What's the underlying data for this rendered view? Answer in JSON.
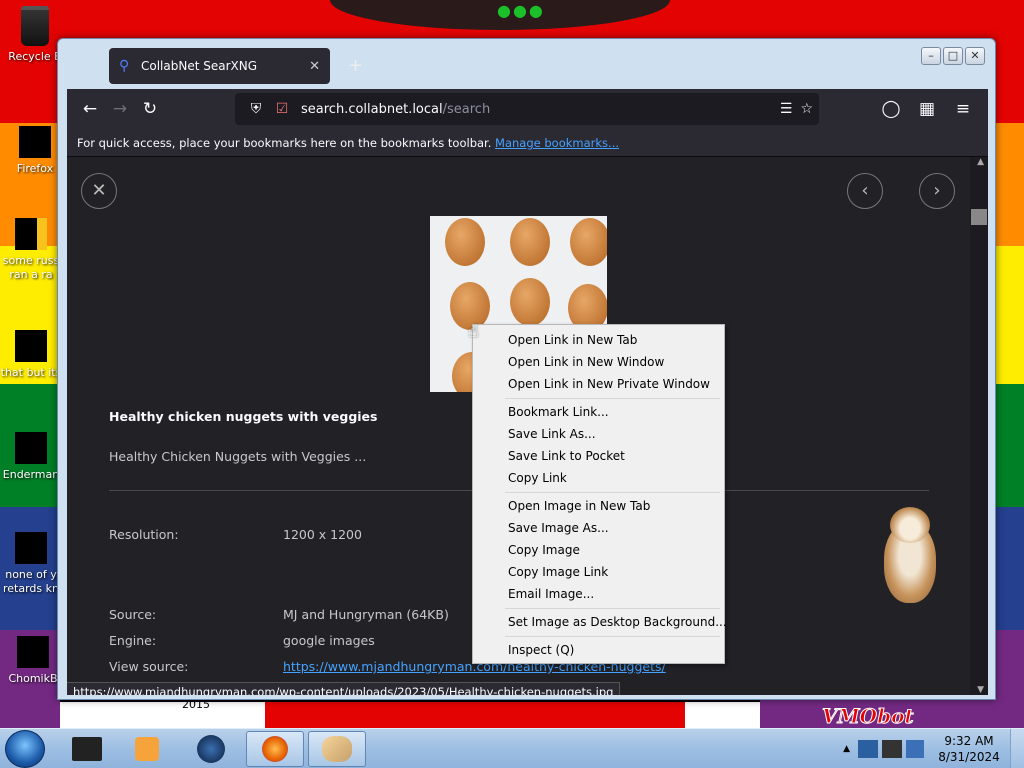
{
  "desktop": {
    "icons": [
      {
        "label": "Recycle B",
        "icon": "recycle-bin-icon"
      },
      {
        "label": "Firefox",
        "icon": "firefox-icon"
      },
      {
        "label": "some russ ran a ra",
        "icon": "file-icon"
      },
      {
        "label": "that but its",
        "icon": "file-icon"
      },
      {
        "label": "Enderman",
        "icon": "file-icon"
      },
      {
        "label": "none of y retards kn",
        "icon": "file-icon"
      },
      {
        "label": "ChomikB",
        "icon": "file-icon"
      }
    ],
    "wallpaper_text": "VMObot",
    "wallpaper_year": "2015"
  },
  "browser": {
    "tab_title": "CollabNet SearXNG",
    "url_host": "search.collabnet.local",
    "url_path": "/search",
    "bookmarks_hint": "For quick access, place your bookmarks here on the bookmarks toolbar.",
    "bookmarks_link": "Manage bookmarks...",
    "status_url": "https://www.mjandhungryman.com/wp-content/uploads/2023/05/Healthy-chicken-nuggets.jpg"
  },
  "result": {
    "title": "Healthy chicken nuggets with veggies",
    "description": "Healthy Chicken Nuggets with Veggies ...",
    "resolution_label": "Resolution:",
    "resolution": "1200 x 1200",
    "source_label": "Source:",
    "source": "MJ and Hungryman (64KB)",
    "engine_label": "Engine:",
    "engine": "google images",
    "view_source_label": "View source:",
    "view_source": "https://www.mjandhungryman.com/healthy-chicken-nuggets/"
  },
  "context_menu": {
    "items": [
      "Open Link in New Tab",
      "Open Link in New Window",
      "Open Link in New Private Window",
      "---",
      "Bookmark Link...",
      "Save Link As...",
      "Save Link to Pocket",
      "Copy Link",
      "---",
      "Open Image in New Tab",
      "Save Image As...",
      "Copy Image",
      "Copy Image Link",
      "Email Image...",
      "---",
      "Set Image as Desktop Background...",
      "---",
      "Inspect (Q)"
    ]
  },
  "taskbar": {
    "time": "9:32 AM",
    "date": "8/31/2024"
  }
}
